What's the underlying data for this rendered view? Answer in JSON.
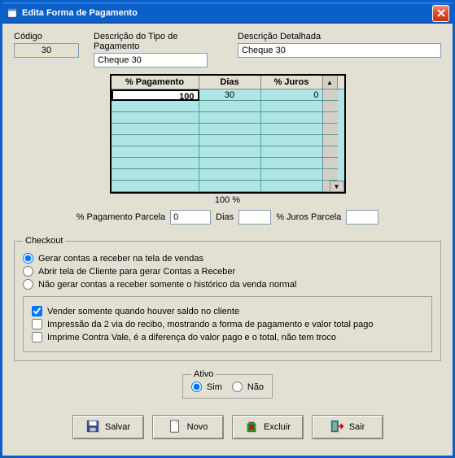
{
  "window": {
    "title": "Edita Forma de Pagamento"
  },
  "fields": {
    "codigo_label": "Código",
    "codigo_value": "30",
    "descr_tipo_label": "Descrição do Tipo de Pagamento",
    "descr_tipo_value": "Cheque 30",
    "descr_det_label": "Descrição Detalhada",
    "descr_det_value": "Cheque 30"
  },
  "grid": {
    "h1": "% Pagamento",
    "h2": "Dias",
    "h3": "% Juros",
    "rows": [
      {
        "pct": "100",
        "dias": "30",
        "juros": "0"
      }
    ],
    "total": "100 %"
  },
  "parcela": {
    "pct_label": "% Pagamento Parcela",
    "pct_value": "0",
    "dias_label": "Dias",
    "dias_value": "",
    "juros_label": "% Juros Parcela",
    "juros_value": ""
  },
  "checkout": {
    "legend": "Checkout",
    "r1": "Gerar contas a receber na tela de vendas",
    "r2": "Abrir tela de Cliente para gerar Contas a Receber",
    "r3": "Não gerar contas a receber somente o histórico da venda normal",
    "c1": "Vender somente quando houver saldo no cliente",
    "c2": "Impressão da 2 via do recibo, mostrando a forma de pagamento e valor total pago",
    "c3": "Imprime Contra Vale, é a diferença do valor pago e o total, não tem troco"
  },
  "ativo": {
    "legend": "Ativo",
    "sim": "Sim",
    "nao": "Não"
  },
  "buttons": {
    "salvar": "Salvar",
    "novo": "Novo",
    "excluir": "Excluir",
    "sair": "Sair"
  }
}
